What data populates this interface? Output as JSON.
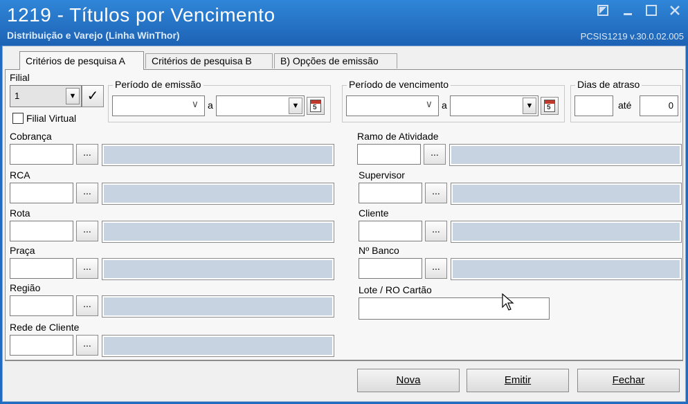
{
  "window": {
    "title": "1219 - Títulos por Vencimento",
    "subtitle": "Distribuição e Varejo (Linha WinThor)",
    "version": "PCSIS1219  v.30.0.02.005"
  },
  "tabs": [
    {
      "label": "Critérios de pesquisa A"
    },
    {
      "label": "Critérios de pesquisa B"
    },
    {
      "label": "B) Opções de emissão"
    }
  ],
  "filial": {
    "label": "Filial",
    "value": "1",
    "virtual_label": "Filial Virtual"
  },
  "periodo_emissao": {
    "label": "Período de emissão",
    "sep": "a"
  },
  "periodo_vencimento": {
    "label": "Período de vencimento",
    "sep": "a"
  },
  "dias_atraso": {
    "label": "Dias de atraso",
    "sep": "até",
    "to_value": "0"
  },
  "left_fields": [
    {
      "label": "Cobrança"
    },
    {
      "label": "RCA"
    },
    {
      "label": "Rota"
    },
    {
      "label": "Praça"
    },
    {
      "label": "Região"
    },
    {
      "label": "Rede de Cliente"
    }
  ],
  "right_fields": [
    {
      "label": "Ramo de Atividade"
    },
    {
      "label": "Supervisor"
    },
    {
      "label": "Cliente"
    },
    {
      "label": "Nº Banco"
    }
  ],
  "lote": {
    "label": "Lote / RO Cartão"
  },
  "lookup_button": "...",
  "calendar_glyph": "5",
  "actions": {
    "nova": "Nova",
    "emitir": "Emitir",
    "fechar": "Fechar"
  },
  "icons": {
    "restore": "restore-icon",
    "minimize": "minimize-icon",
    "maximize": "maximize-icon",
    "close": "close-icon"
  }
}
